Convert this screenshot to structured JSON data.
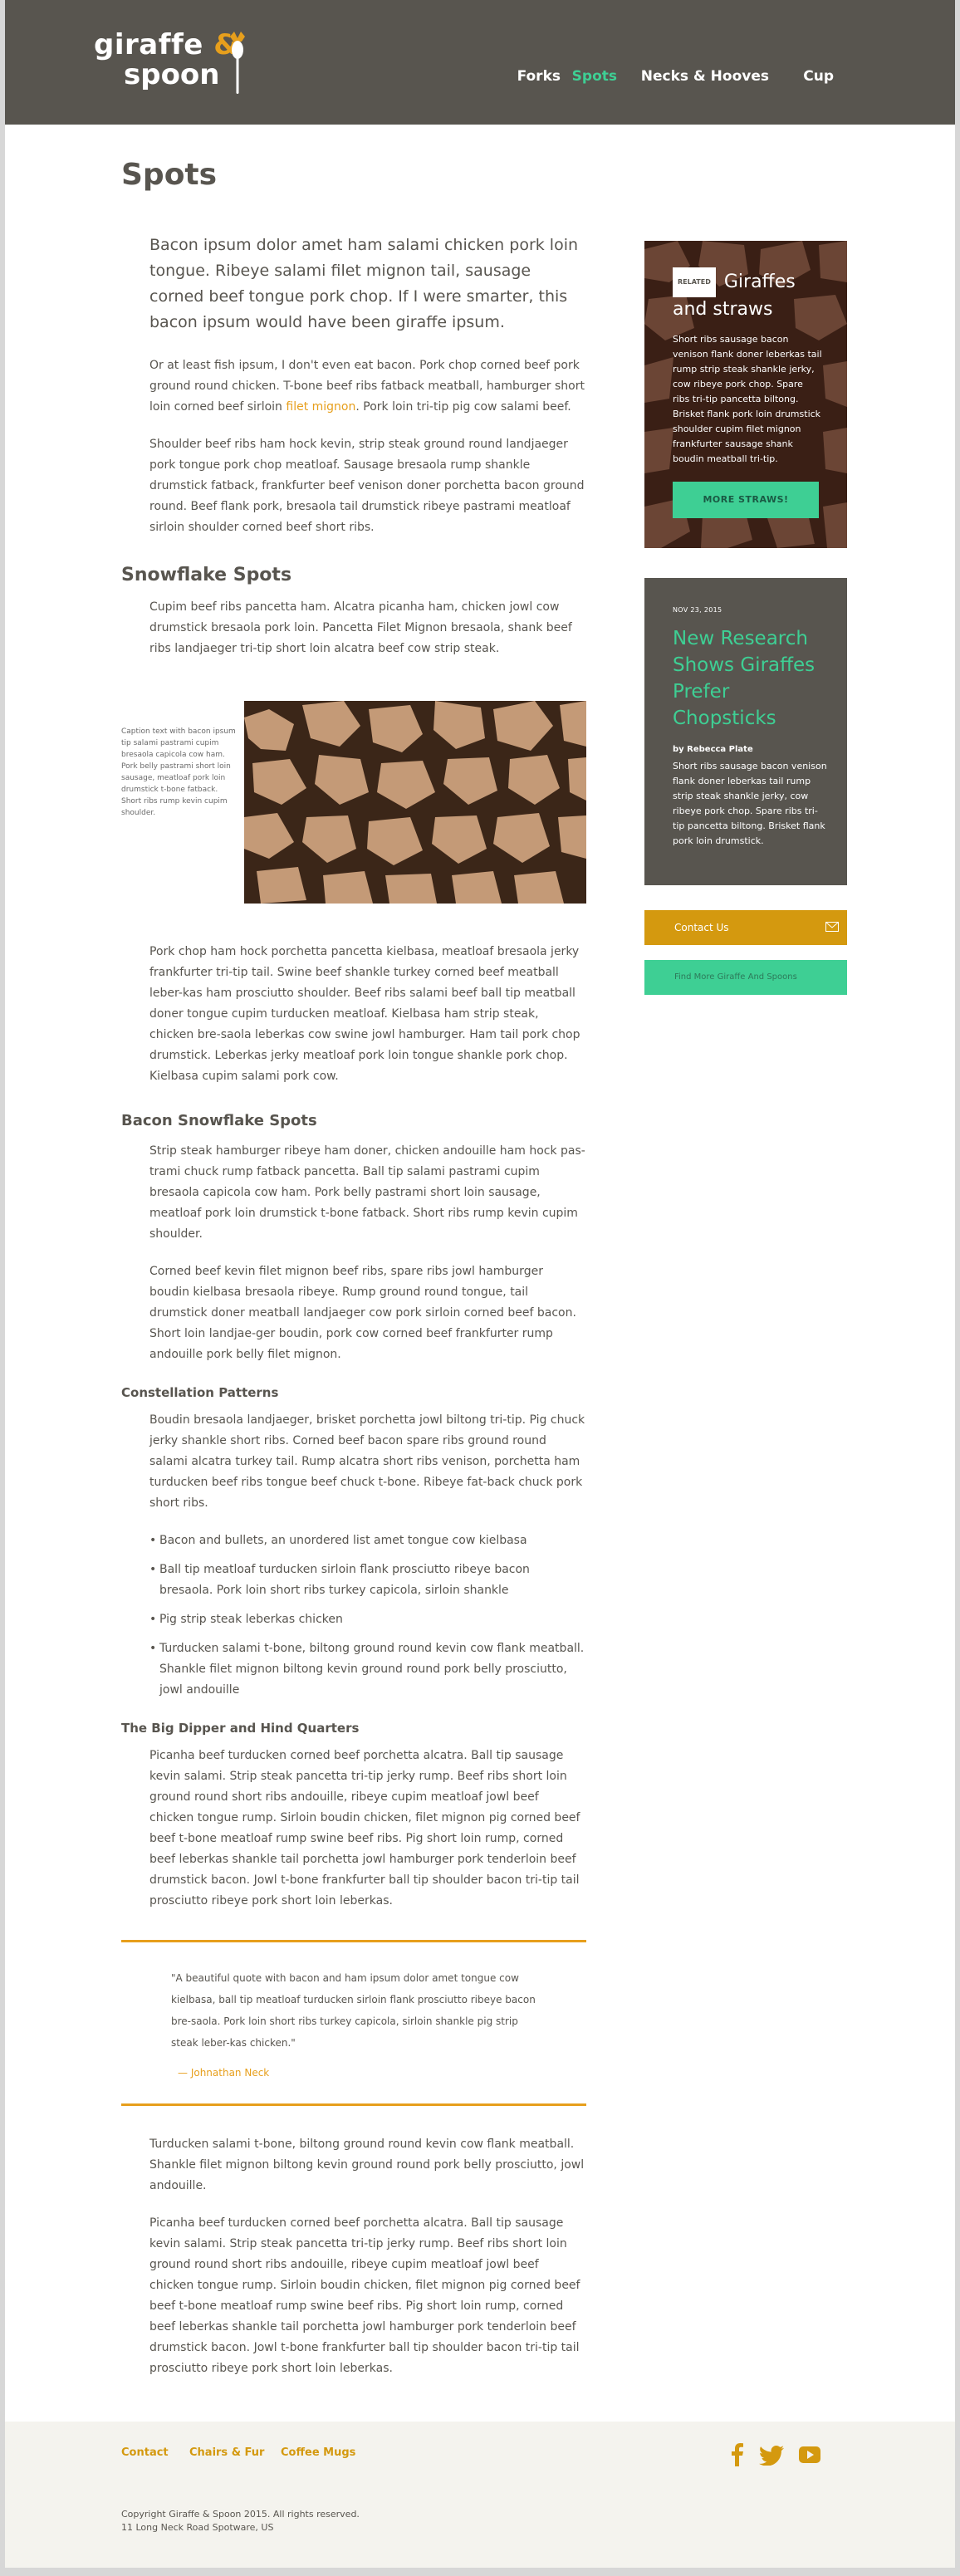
{
  "header": {
    "logo": {
      "line1": "giraffe",
      "amp": "&",
      "line2": "spoon"
    },
    "nav": [
      {
        "label": "Forks",
        "active": false
      },
      {
        "label": "Spots",
        "active": true
      },
      {
        "label": "Necks & Hooves",
        "active": false
      },
      {
        "label": "Cup",
        "active": false
      }
    ]
  },
  "page": {
    "title": "Spots",
    "lead": "Bacon ipsum dolor amet ham salami chicken pork loin tongue. Ribeye salami filet mignon tail, sausage corned beef tongue pork chop. If I were smarter, this bacon ipsum would have been giraffe ipsum.",
    "p1_before": "Or at least fish ipsum, I don't even eat bacon. Pork chop corned beef pork ground round chicken. T-bone beef ribs fatback meatball, hamburger short loin corned beef sirloin ",
    "p1_link": "filet mignon",
    "p1_after": ". Pork loin tri-tip pig cow salami beef.",
    "p2": "Shoulder beef ribs ham hock kevin, strip steak ground round landjaeger pork tongue pork chop meatloaf. Sausage bresaola rump shankle drumstick fatback, frankfurter beef venison doner porchetta bacon ground round. Beef flank pork, bresaola tail drumstick ribeye pastrami meatloaf sirloin shoulder corned beef short ribs.",
    "h_snowflake": "Snowflake Spots",
    "p3": "Cupim beef ribs pancetta ham. Alcatra picanha ham, chicken jowl cow drumstick bresaola pork loin. Pancetta Filet Mignon bresaola, shank beef ribs landjaeger tri-tip short loin alcatra beef cow strip steak.",
    "caption": "Caption text with bacon ipsum tip salami pastrami cupim bresaola capicola cow ham. Pork belly pastrami short loin sausage, meatloaf pork loin drumstick t-bone fatback. Short ribs rump kevin cupim shoulder.",
    "p4": "Pork chop ham hock porchetta pancetta kielbasa, meatloaf bresaola jerky frankfurter tri-tip tail. Swine beef shankle turkey corned beef meatball leber-kas ham prosciutto shoulder. Beef ribs salami beef ball tip meatball doner tongue cupim turducken meatloaf. Kielbasa ham strip steak, chicken bre-saola leberkas cow swine jowl hamburger. Ham tail pork chop drumstick. Leberkas jerky meatloaf pork loin tongue shankle pork chop. Kielbasa cupim salami pork cow.",
    "h_bacon": "Bacon Snowflake Spots",
    "p5": "Strip steak hamburger ribeye ham doner, chicken andouille ham hock pas-trami chuck rump fatback pancetta. Ball tip salami pastrami cupim bresaola capicola cow ham. Pork belly pastrami short loin sausage, meatloaf pork loin drumstick t-bone fatback. Short ribs rump kevin cupim shoulder.",
    "p6": "Corned beef kevin filet mignon beef ribs, spare ribs jowl hamburger boudin kielbasa bresaola ribeye. Rump ground round tongue, tail drumstick doner meatball landjaeger cow pork sirloin corned beef bacon. Short loin landjae-ger boudin, pork cow corned beef frankfurter rump andouille pork belly filet mignon.",
    "h_constellation": "Constellation Patterns",
    "p7": "Boudin bresaola landjaeger, brisket porchetta jowl biltong tri-tip. Pig chuck jerky shankle short ribs. Corned beef bacon spare ribs ground round salami alcatra turkey tail. Rump alcatra short ribs venison, porchetta ham turducken beef ribs tongue beef chuck t-bone. Ribeye fat-back chuck pork short ribs.",
    "bullets": [
      "Bacon and bullets, an unordered list amet tongue cow kielbasa",
      "Ball tip meatloaf turducken sirloin flank prosciutto ribeye bacon bresaola. Pork loin short ribs turkey capicola, sirloin shankle",
      "Pig strip steak leberkas chicken",
      "Turducken salami t-bone, biltong ground round kevin cow flank meatball. Shankle filet mignon biltong kevin ground round pork belly prosciutto, jowl andouille"
    ],
    "h_dipper": "The Big Dipper and Hind Quarters",
    "p8": "Picanha beef turducken corned beef porchetta alcatra. Ball tip sausage kevin salami. Strip steak pancetta tri-tip jerky rump. Beef ribs short loin ground round short ribs andouille, ribeye cupim meatloaf jowl beef chicken tongue rump. Sirloin boudin chicken, filet mignon pig corned beef beef t-bone meatloaf rump swine beef ribs. Pig short loin rump, corned beef leberkas shankle tail porchetta jowl hamburger pork tenderloin beef drumstick bacon. Jowl t-bone frankfurter ball tip shoulder bacon tri-tip tail prosciutto ribeye pork short loin leberkas.",
    "quote": "\"A beautiful quote with bacon and ham ipsum dolor amet tongue cow kielbasa, ball tip meatloaf turducken sirloin flank prosciutto ribeye bacon bre-saola. Pork loin short ribs turkey capicola, sirloin shankle pig strip steak leber-kas chicken.\"",
    "quote_author": "— Johnathan Neck",
    "p9": "Turducken salami t-bone, biltong ground round kevin cow flank meatball. Shankle filet mignon biltong kevin ground round pork belly prosciutto, jowl andouille.",
    "p10": "Picanha beef turducken corned beef porchetta alcatra. Ball tip sausage kevin salami. Strip steak pancetta tri-tip jerky rump. Beef ribs short loin ground round short ribs andouille, ribeye cupim meatloaf jowl beef chicken tongue rump. Sirloin boudin chicken, filet mignon pig corned beef beef t-bone meatloaf rump swine beef ribs. Pig short loin rump, corned beef leberkas shankle tail porchetta jowl hamburger pork tenderloin beef drumstick bacon. Jowl t-bone frankfurter ball tip shoulder bacon tri-tip tail prosciutto ribeye pork short loin leberkas."
  },
  "sidebar": {
    "related": {
      "tag": "RELATED",
      "title": "Giraffes and straws",
      "body": "Short ribs sausage bacon venison flank doner leberkas tail rump strip steak shankle jerky, cow ribeye pork chop. Spare ribs tri-tip pancetta biltong. Brisket flank pork loin drumstick shoulder cupim filet mignon frankfurter sausage shank boudin meatball tri-tip.",
      "button": "MORE STRAWS!"
    },
    "article": {
      "date": "NOV 23, 2015",
      "title": "New Research Shows Giraffes Prefer Chopsticks",
      "byline": "by Rebecca Plate",
      "body": "Short ribs sausage bacon venison flank doner leberkas tail rump strip steak shankle jerky, cow ribeye pork chop. Spare ribs tri-tip pancetta biltong. Brisket flank pork loin drumstick."
    },
    "contact_button": "Contact Us",
    "find_button": "Find More Giraffe And Spoons"
  },
  "footer": {
    "links": [
      "Contact",
      "Chairs & Fur",
      "Coffee Mugs"
    ],
    "copyright": "Copyright Giraffe & Spoon 2015. All rights reserved.",
    "address": "11 Long Neck Road Spotware, US"
  },
  "colors": {
    "header_bg": "#58554f",
    "accent_green": "#3ecf94",
    "accent_orange": "#e79f1c",
    "contact_gold": "#d4990f",
    "footer_bg": "#f4f3ee"
  },
  "icons": [
    "spoon-logo-icon",
    "mail-icon",
    "facebook-icon",
    "twitter-icon",
    "youtube-icon"
  ]
}
